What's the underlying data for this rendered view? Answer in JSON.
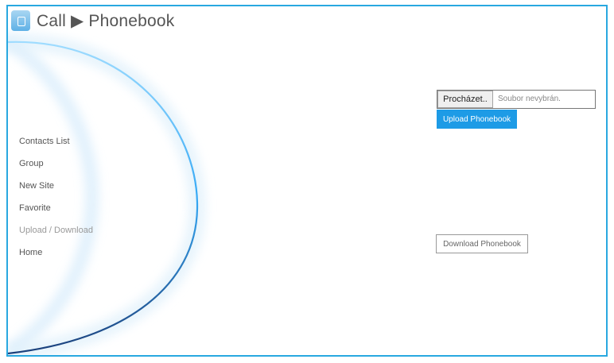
{
  "header": {
    "icon": "phone-app-icon",
    "title": "Call ▶ Phonebook"
  },
  "menu": {
    "items": [
      {
        "label": "Contacts List"
      },
      {
        "label": "Group"
      },
      {
        "label": "New Site"
      },
      {
        "label": "Favorite"
      },
      {
        "label": "Upload / Download",
        "active": true
      },
      {
        "label": "Home"
      }
    ]
  },
  "upload": {
    "browse_label": "Procházet..",
    "file_placeholder": "Soubor nevybrán.",
    "upload_label": "Upload Phonebook"
  },
  "download": {
    "download_label": "Download Phonebook"
  },
  "colors": {
    "accent": "#1d9be6",
    "frame": "#29a8e0"
  }
}
